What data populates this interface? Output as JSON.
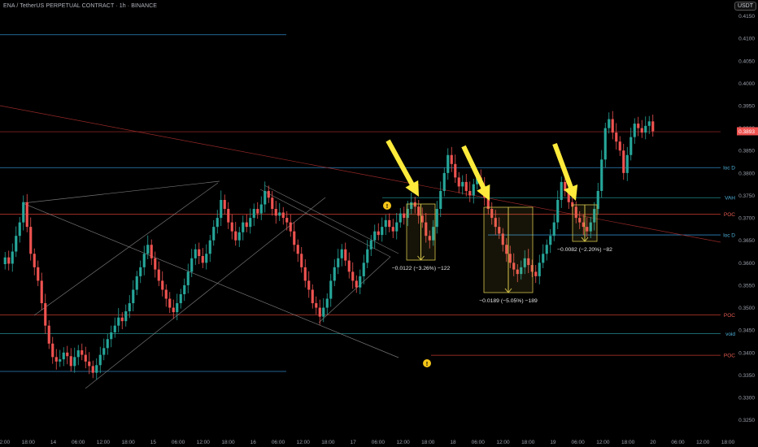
{
  "header": {
    "title": "ENA / TetherUS PERPETUAL CONTRACT · 1h · BINANCE",
    "currency": "USDT"
  },
  "colors": {
    "up": "#26a69a",
    "down": "#ef5350",
    "arrow": "#ffeb3b",
    "measure": "#d4c34a"
  },
  "chart_data": {
    "type": "candlestick",
    "ylim": [
      0.3215,
      0.416
    ],
    "y_ticks": [
      "0.4150",
      "0.4100",
      "0.4050",
      "0.4000",
      "0.3950",
      "0.3900",
      "0.3850",
      "0.3800",
      "0.3750",
      "0.3700",
      "0.3650",
      "0.3600",
      "0.3550",
      "0.3500",
      "0.3450",
      "0.3400",
      "0.3350",
      "0.3300",
      "0.3250"
    ],
    "x_ticks": [
      "12:00",
      "18:00",
      "14",
      "06:00",
      "12:00",
      "18:00",
      "15",
      "06:00",
      "12:00",
      "18:00",
      "16",
      "06:00",
      "12:00",
      "18:00",
      "17",
      "06:00",
      "12:00",
      "18:00",
      "18",
      "06:00",
      "12:00",
      "18:00",
      "19",
      "06:00",
      "12:00",
      "18:00",
      "20",
      "06:00",
      "12:00",
      "18:00"
    ],
    "last_price": "0.3893",
    "level_lines": [
      {
        "label": "",
        "value": 0.4108,
        "color": "#2e86c1"
      },
      {
        "label": "",
        "value": 0.3892,
        "color": "#7a1f1f"
      },
      {
        "label": "loc D",
        "value": 0.3812,
        "color": "#2e86c1"
      },
      {
        "label": "VAH",
        "value": 0.3745,
        "color": "#1f8a8a"
      },
      {
        "label": "POC",
        "value": 0.3708,
        "color": "#c0392b"
      },
      {
        "label": "loc D",
        "value": 0.3662,
        "color": "#2e86c1"
      },
      {
        "label": "POC",
        "value": 0.3484,
        "color": "#c0392b"
      },
      {
        "label": "void",
        "value": 0.3442,
        "color": "#1f8a8a"
      },
      {
        "label": "",
        "value": 0.3358,
        "color": "#2e86c1"
      },
      {
        "label": "POC",
        "value": 0.3394,
        "color": "#c0392b"
      }
    ],
    "measurements": [
      {
        "label": "−0.0122 (−3.26%) −122"
      },
      {
        "label": "−0.0189 (−5.05%) −189"
      },
      {
        "label": "−0.0082 (−2.20%) −82"
      }
    ],
    "markers": [
      "!",
      "!"
    ],
    "close": [
      0.3612,
      0.3598,
      0.3625,
      0.366,
      0.369,
      0.3735,
      0.368,
      0.362,
      0.359,
      0.356,
      0.351,
      0.346,
      0.342,
      0.339,
      0.338,
      0.3385,
      0.34,
      0.3392,
      0.337,
      0.339,
      0.3405,
      0.3395,
      0.338,
      0.337,
      0.3355,
      0.3372,
      0.3395,
      0.341,
      0.343,
      0.3445,
      0.346,
      0.3478,
      0.347,
      0.3492,
      0.351,
      0.354,
      0.357,
      0.359,
      0.362,
      0.364,
      0.361,
      0.3585,
      0.356,
      0.354,
      0.352,
      0.35,
      0.349,
      0.351,
      0.353,
      0.355,
      0.358,
      0.361,
      0.363,
      0.3615,
      0.36,
      0.362,
      0.365,
      0.368,
      0.37,
      0.374,
      0.372,
      0.369,
      0.367,
      0.365,
      0.3668,
      0.369,
      0.368,
      0.37,
      0.372,
      0.371,
      0.373,
      0.376,
      0.3745,
      0.372,
      0.3705,
      0.3712,
      0.37,
      0.369,
      0.367,
      0.364,
      0.362,
      0.359,
      0.356,
      0.354,
      0.351,
      0.35,
      0.348,
      0.35,
      0.352,
      0.356,
      0.359,
      0.361,
      0.363,
      0.3605,
      0.358,
      0.356,
      0.3545,
      0.357,
      0.36,
      0.363,
      0.365,
      0.367,
      0.3662,
      0.368,
      0.3695,
      0.368,
      0.367,
      0.369,
      0.371,
      0.37,
      0.372,
      0.3735,
      0.3725,
      0.3705,
      0.369,
      0.366,
      0.365,
      0.368,
      0.372,
      0.376,
      0.38,
      0.384,
      0.382,
      0.379,
      0.377,
      0.378,
      0.376,
      0.375,
      0.3775,
      0.379,
      0.377,
      0.3745,
      0.372,
      0.37,
      0.368,
      0.3665,
      0.364,
      0.362,
      0.36,
      0.3585,
      0.3575,
      0.359,
      0.361,
      0.3595,
      0.358,
      0.357,
      0.36,
      0.362,
      0.364,
      0.366,
      0.369,
      0.374,
      0.378,
      0.376,
      0.3735,
      0.3725,
      0.37,
      0.369,
      0.368,
      0.367,
      0.369,
      0.372,
      0.376,
      0.383,
      0.39,
      0.392,
      0.389,
      0.387,
      0.385,
      0.38,
      0.384,
      0.388,
      0.391,
      0.39,
      0.389,
      0.3905,
      0.3915,
      0.3893
    ]
  }
}
